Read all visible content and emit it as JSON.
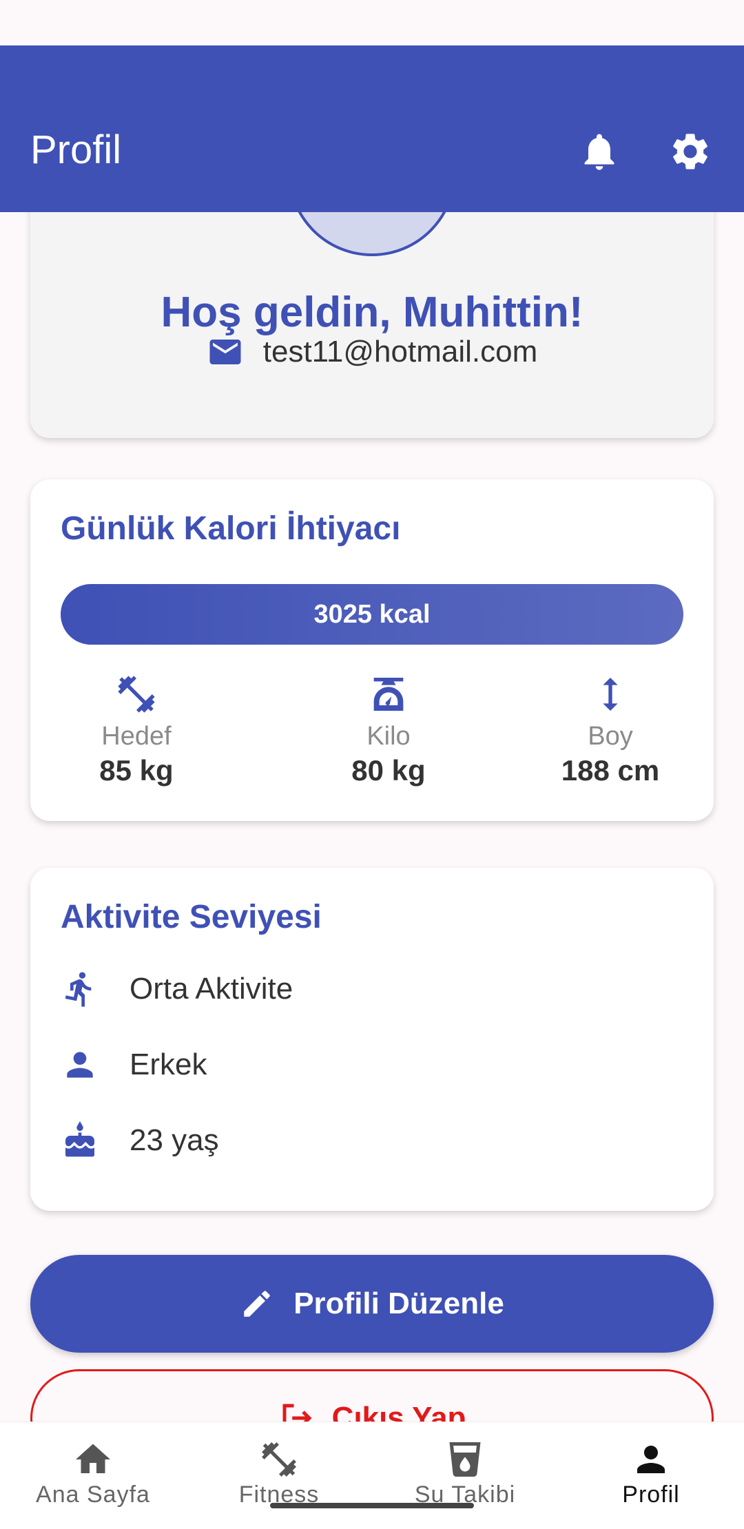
{
  "header": {
    "title": "Profil",
    "bell_icon": "bell-icon",
    "settings_icon": "gear-icon"
  },
  "profile": {
    "welcome": "Hoş geldin, Muhittin!",
    "email": "test11@hotmail.com"
  },
  "calorie_card": {
    "title": "Günlük Kalori İhtiyacı",
    "kcal": "3025 kcal",
    "stats": [
      {
        "label": "Hedef",
        "value": "85 kg",
        "icon": "fitness-icon"
      },
      {
        "label": "Kilo",
        "value": "80 kg",
        "icon": "scale-icon"
      },
      {
        "label": "Boy",
        "value": "188 cm",
        "icon": "height-icon"
      }
    ]
  },
  "activity_card": {
    "title": "Aktivite Seviyesi",
    "items": [
      {
        "text": "Orta Aktivite",
        "icon": "run-icon"
      },
      {
        "text": "Erkek",
        "icon": "person-icon"
      },
      {
        "text": "23 yaş",
        "icon": "cake-icon"
      }
    ]
  },
  "buttons": {
    "edit": "Profili Düzenle",
    "logout": "Çıkış Yap"
  },
  "bottom_nav": [
    {
      "label": "Ana Sayfa",
      "icon": "home-icon"
    },
    {
      "label": "Fitness",
      "icon": "fitness-icon"
    },
    {
      "label": "Su Takibi",
      "icon": "water-cup-icon"
    },
    {
      "label": "Profil",
      "icon": "person-icon",
      "active": true
    }
  ],
  "colors": {
    "primary": "#3f51b5",
    "danger": "#e11a1a",
    "background": "#fdf8fa"
  }
}
